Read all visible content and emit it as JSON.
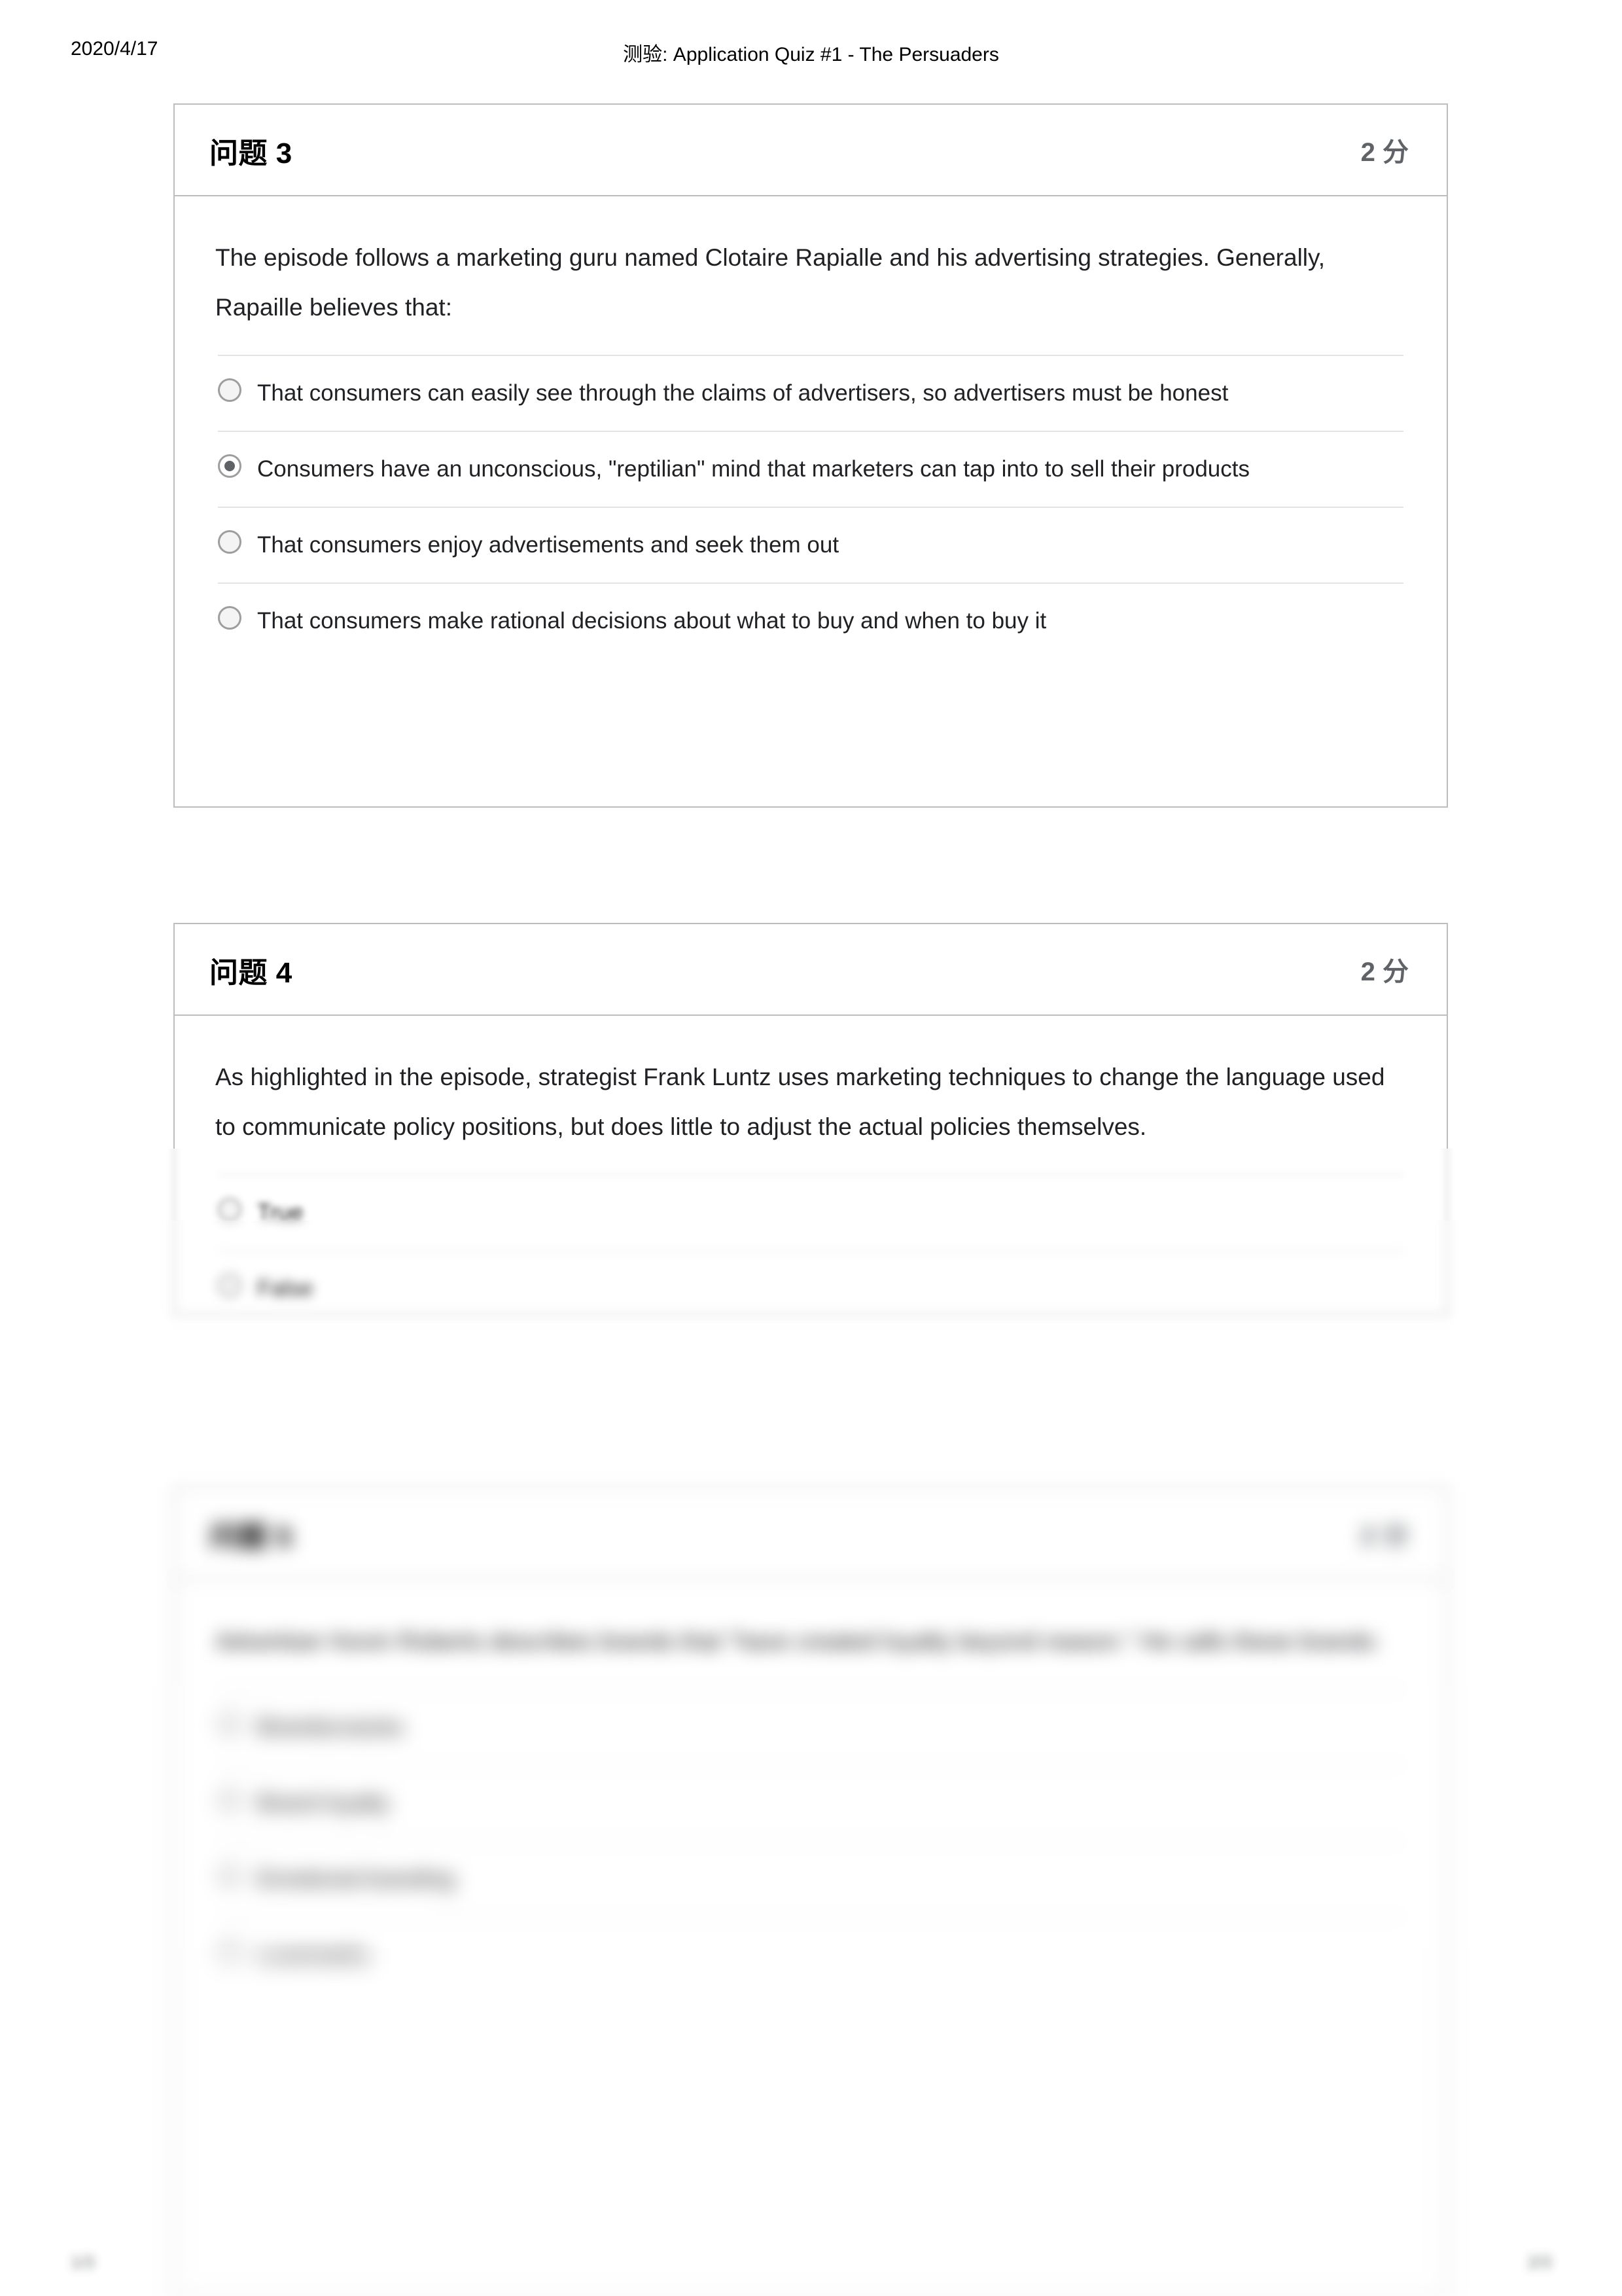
{
  "page": {
    "date": "2020/4/17",
    "title": "测验: Application Quiz #1 - The Persuaders",
    "footer_left": "1/3",
    "footer_right": "2/3"
  },
  "points_suffix": "分",
  "questions": [
    {
      "label": "问题 3",
      "points": "2 分",
      "text": "The episode follows a marketing guru named Clotaire Rapialle and his advertising strategies. Generally, Rapaille believes that:",
      "options": [
        {
          "label": "That consumers can easily see through the claims of advertisers, so advertisers must be honest",
          "selected": false
        },
        {
          "label": "Consumers have an unconscious, \"reptilian\" mind that marketers can tap into to sell their products",
          "selected": true
        },
        {
          "label": "That consumers enjoy advertisements and seek them out",
          "selected": false
        },
        {
          "label": "That consumers make rational decisions about what to buy and when to buy it",
          "selected": false
        }
      ]
    },
    {
      "label": "问题 4",
      "points": "2 分",
      "text": "As highlighted in the episode, strategist Frank Luntz uses marketing techniques to change the language used to communicate policy positions, but does little to adjust the actual policies themselves.",
      "options": [
        {
          "label": "True",
          "selected": false
        },
        {
          "label": "False",
          "selected": false
        }
      ]
    },
    {
      "label": "问题 5",
      "points": "2 分",
      "text": "Advertiser Kevin Roberts describes brands that \"have created loyalty beyond reason.\" He calls these brands:",
      "options": [
        {
          "label": "Brandocracies",
          "selected": false
        },
        {
          "label": "Brand loyalty",
          "selected": false
        },
        {
          "label": "Emotional branding",
          "selected": false
        },
        {
          "label": "Lovemarks",
          "selected": false
        }
      ]
    }
  ],
  "colors": {
    "card_border": "#bdbdbd",
    "divider": "#e3e3e3",
    "points_text": "#5f6368",
    "body_text": "#202124",
    "radio_ring": "#9e9e9e",
    "radio_dot": "#5f6368"
  }
}
